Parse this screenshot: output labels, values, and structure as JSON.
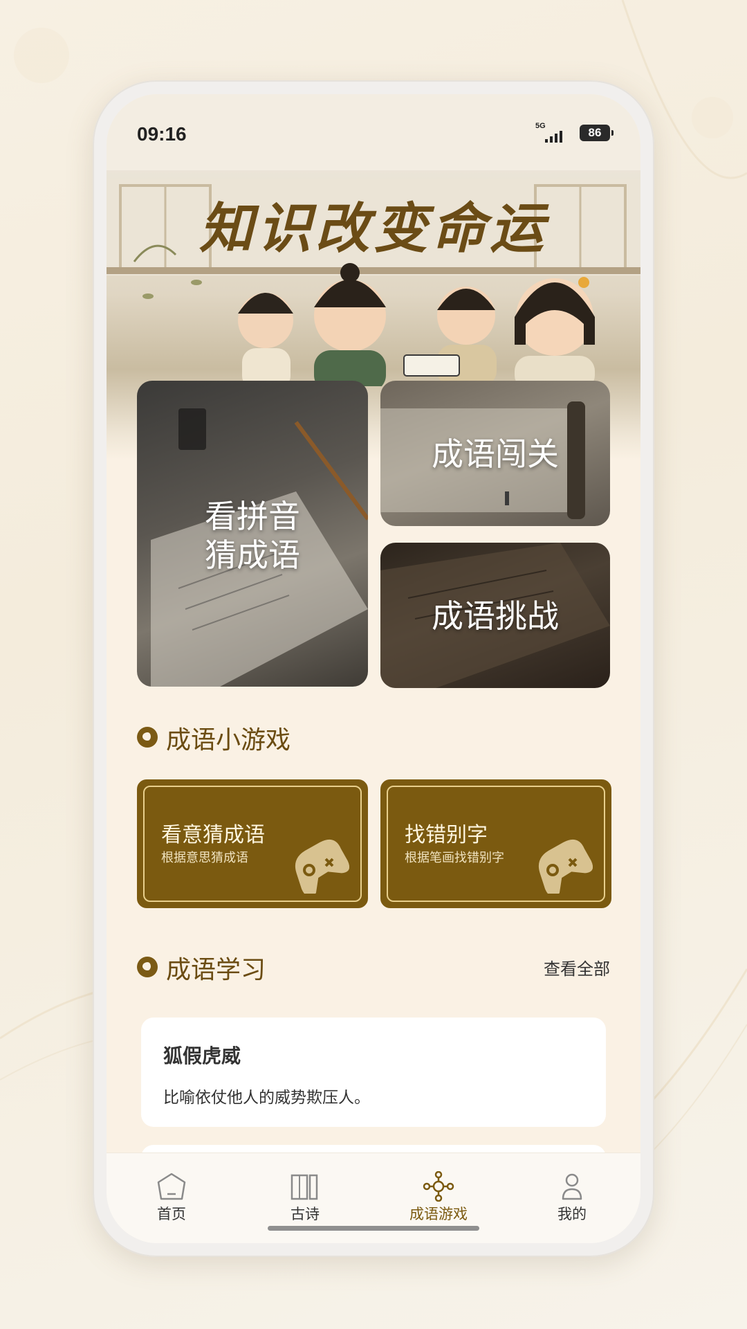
{
  "status": {
    "time": "09:16",
    "network": "5G",
    "battery": "86"
  },
  "banner": {
    "slogan": "知识改变命运"
  },
  "feature_cards": [
    {
      "title_line1": "看拼音",
      "title_line2": "猜成语"
    },
    {
      "title": "成语闯关"
    },
    {
      "title": "成语挑战"
    }
  ],
  "games_section": {
    "title": "成语小游戏",
    "items": [
      {
        "title": "看意猜成语",
        "subtitle": "根据意思猜成语"
      },
      {
        "title": "找错别字",
        "subtitle": "根据笔画找错别字"
      }
    ]
  },
  "study_section": {
    "title": "成语学习",
    "more_label": "查看全部",
    "items": [
      {
        "word": "狐假虎威",
        "meaning": "比喻依仗他人的威势欺压人。"
      }
    ]
  },
  "tabbar": {
    "items": [
      {
        "label": "首页",
        "icon": "home-icon"
      },
      {
        "label": "古诗",
        "icon": "book-icon"
      },
      {
        "label": "成语游戏",
        "icon": "game-node-icon",
        "active": true
      },
      {
        "label": "我的",
        "icon": "user-icon"
      }
    ],
    "active_color": "#7b5a10"
  },
  "colors": {
    "accent": "#7b5a10",
    "background": "#faf1e4"
  }
}
